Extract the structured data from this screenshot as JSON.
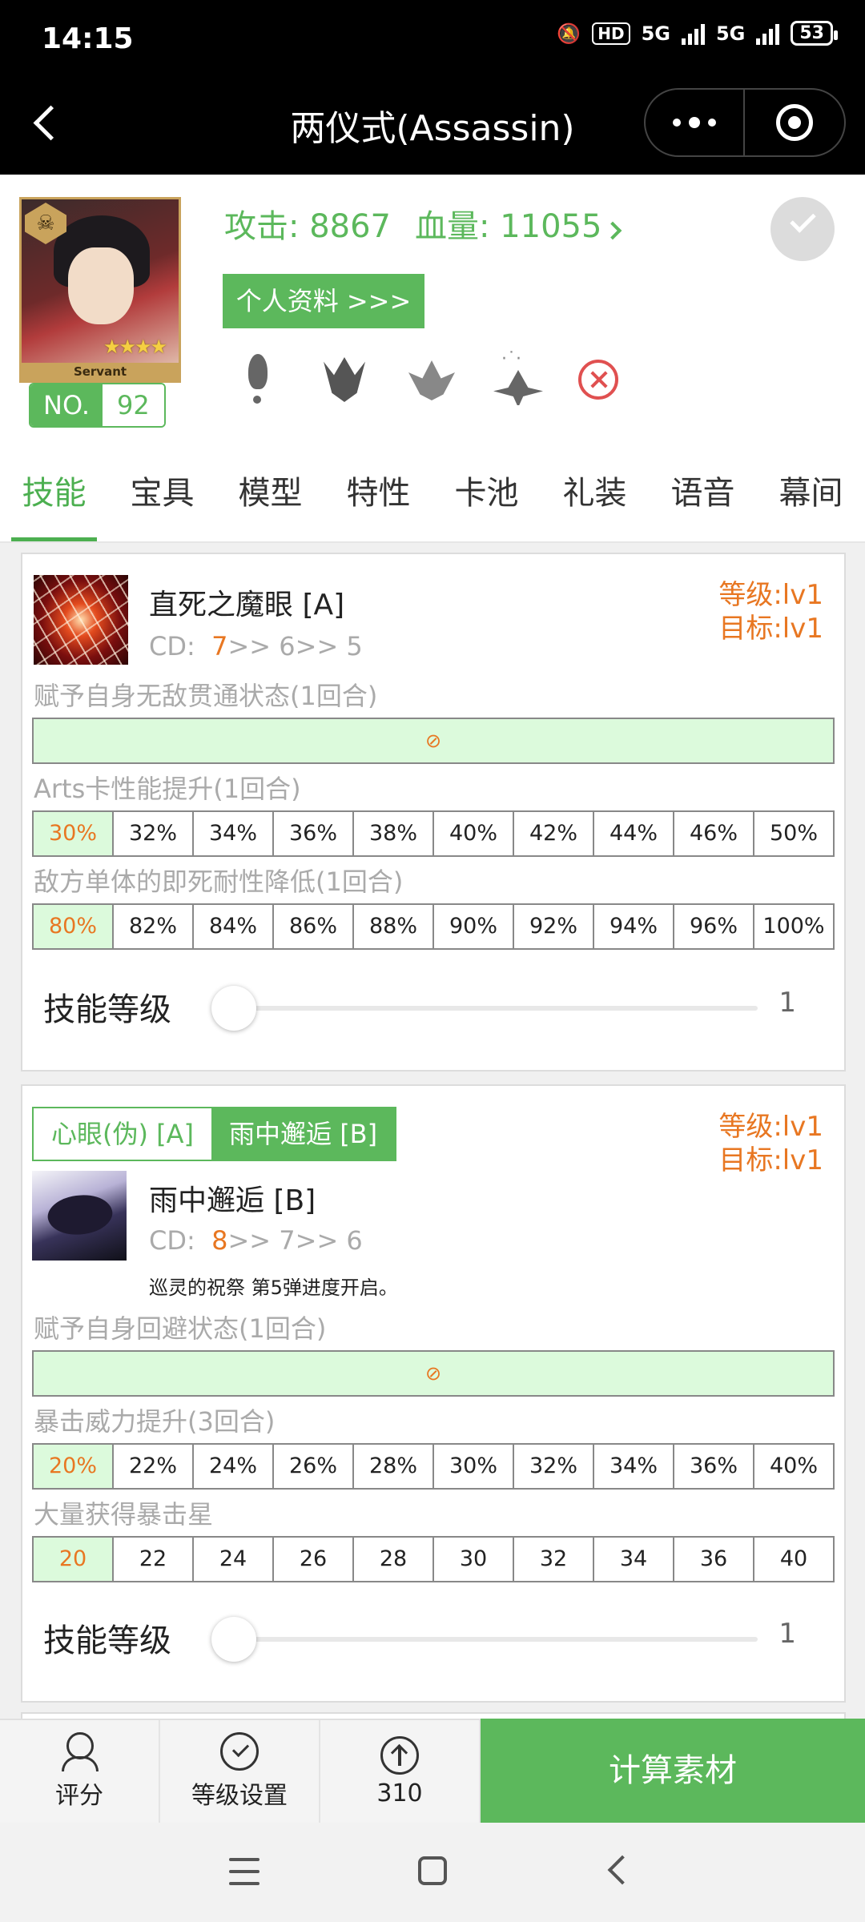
{
  "status_bar": {
    "time": "14:15",
    "hd_label": "HD",
    "network_1": "5G",
    "network_2": "5G",
    "battery": "53"
  },
  "title_bar": {
    "title": "两仪式(Assassin)"
  },
  "servant": {
    "portrait_label": "Servant",
    "stars": "★★★★",
    "no_label": "NO.",
    "no_value": "92",
    "atk_label": "攻击:",
    "atk_value": "8867",
    "hp_label": "血量:",
    "hp_value": "11055",
    "profile_button": "个人资料 >>>"
  },
  "tabs": [
    "技能",
    "宝具",
    "模型",
    "特性",
    "卡池",
    "礼装",
    "语音",
    "幕间"
  ],
  "skill1": {
    "name": "直死之魔眼 [A]",
    "cd_label": "CD:",
    "cd_current": "7",
    "cd_rest": ">> 6>> 5",
    "level_label": "等级:lv1",
    "target_label": "目标:lv1",
    "effects": [
      {
        "title": "赋予自身无敌贯通状态(1回合)",
        "single": "⊘"
      },
      {
        "title": "Arts卡性能提升(1回合)",
        "values": [
          "30%",
          "32%",
          "34%",
          "36%",
          "38%",
          "40%",
          "42%",
          "44%",
          "46%",
          "50%"
        ]
      },
      {
        "title": "敌方单体的即死耐性降低(1回合)",
        "values": [
          "80%",
          "82%",
          "84%",
          "86%",
          "88%",
          "90%",
          "92%",
          "94%",
          "96%",
          "100%"
        ]
      }
    ],
    "slider_label": "技能等级",
    "slider_value": "1",
    "slider_fraction": 0
  },
  "skill2": {
    "switch_options": [
      "心眼(伪) [A]",
      "雨中邂逅 [B]"
    ],
    "name": "雨中邂逅 [B]",
    "cd_label": "CD:",
    "cd_current": "8",
    "cd_rest": ">> 7>> 6",
    "note": "巡灵的祝祭 第5弹进度开启。",
    "level_label": "等级:lv1",
    "target_label": "目标:lv1",
    "effects": [
      {
        "title": "赋予自身回避状态(1回合)",
        "single": "⊘"
      },
      {
        "title": "暴击威力提升(3回合)",
        "values": [
          "20%",
          "22%",
          "24%",
          "26%",
          "28%",
          "30%",
          "32%",
          "34%",
          "36%",
          "40%"
        ]
      },
      {
        "title": "大量获得暴击星",
        "values": [
          "20",
          "22",
          "24",
          "26",
          "28",
          "30",
          "32",
          "34",
          "36",
          "40"
        ]
      }
    ],
    "slider_label": "技能等级",
    "slider_value": "1",
    "slider_fraction": 0
  },
  "bottom_bar": {
    "rate_label": "评分",
    "level_settings_label": "等级设置",
    "upgrade_count": "310",
    "calc_button": "计算素材"
  },
  "colors": {
    "accent_green": "#5cb85c",
    "highlight_orange": "#e87722",
    "cell_green": "#dcfadc"
  }
}
